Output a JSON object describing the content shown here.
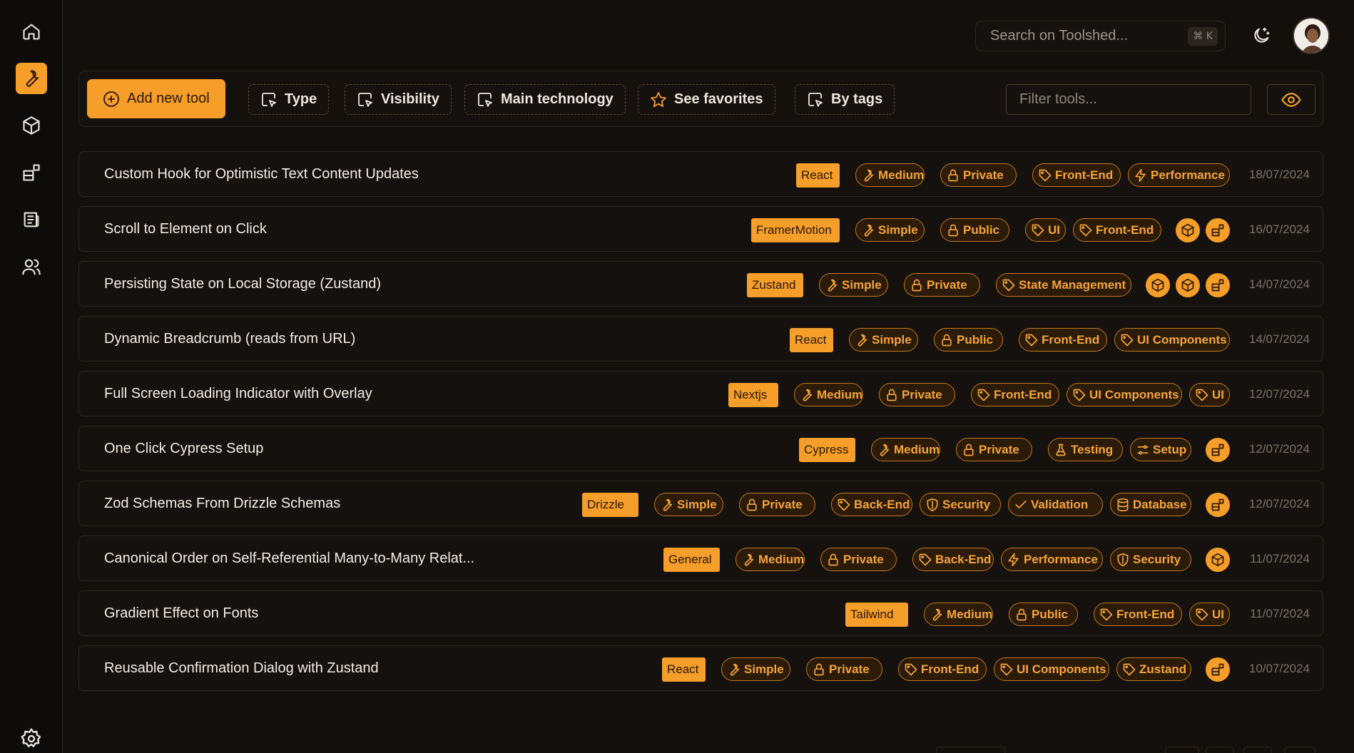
{
  "sidebar": {
    "items": [
      {
        "name": "home",
        "icon": "home-icon",
        "active": false
      },
      {
        "name": "tools",
        "icon": "wrench-icon",
        "active": true
      },
      {
        "name": "packages",
        "icon": "box-icon",
        "active": false
      },
      {
        "name": "components",
        "icon": "blocks-icon",
        "active": false
      },
      {
        "name": "news",
        "icon": "newspaper-icon",
        "active": false
      },
      {
        "name": "users",
        "icon": "users-icon",
        "active": false
      }
    ],
    "settings_icon": "gear-icon"
  },
  "header": {
    "search_placeholder": "Search on Toolshed...",
    "search_shortcut": "⌘ K",
    "theme_icon": "moon-icon"
  },
  "toolbar": {
    "add_label": "Add new tool",
    "type_label": "Type",
    "visibility_label": "Visibility",
    "tech_label": "Main technology",
    "favorites_label": "See favorites",
    "tags_label": "By tags",
    "filter_placeholder": "Filter tools...",
    "view_icon": "eye-icon"
  },
  "colors": {
    "accent": "#f59e2a",
    "background": "#120f0c",
    "chip_bg": "#2c1b08",
    "chip_border": "#c27a1f"
  },
  "tools": [
    {
      "title": "Custom Hook for Optimistic Text Content Updates",
      "tech": "React",
      "level": "Medium",
      "visibility": "Private",
      "tags": [
        {
          "label": "Front-End",
          "icon": "tag"
        },
        {
          "label": "Performance",
          "icon": "bolt"
        }
      ],
      "extras": [],
      "date": "18/07/2024"
    },
    {
      "title": "Scroll to Element on Click",
      "tech": "FramerMotion",
      "level": "Simple",
      "visibility": "Public",
      "tags": [
        {
          "label": "UI",
          "icon": "tag"
        },
        {
          "label": "Front-End",
          "icon": "tag"
        }
      ],
      "extras": [
        "box",
        "blocks"
      ],
      "date": "16/07/2024"
    },
    {
      "title": "Persisting State on Local Storage (Zustand)",
      "tech": "Zustand",
      "level": "Simple",
      "visibility": "Private",
      "tags": [
        {
          "label": "State Management",
          "icon": "tag"
        }
      ],
      "extras": [
        "box",
        "box",
        "blocks"
      ],
      "date": "14/07/2024"
    },
    {
      "title": "Dynamic Breadcrumb (reads from URL)",
      "tech": "React",
      "level": "Simple",
      "visibility": "Public",
      "tags": [
        {
          "label": "Front-End",
          "icon": "tag"
        },
        {
          "label": "UI Components",
          "icon": "tag"
        }
      ],
      "extras": [],
      "date": "14/07/2024"
    },
    {
      "title": "Full Screen Loading Indicator with Overlay",
      "tech": "Nextjs",
      "level": "Medium",
      "visibility": "Private",
      "tags": [
        {
          "label": "Front-End",
          "icon": "tag"
        },
        {
          "label": "UI Components",
          "icon": "tag"
        },
        {
          "label": "UI",
          "icon": "tag"
        }
      ],
      "extras": [],
      "date": "12/07/2024"
    },
    {
      "title": "One Click Cypress Setup",
      "tech": "Cypress",
      "level": "Medium",
      "visibility": "Private",
      "tags": [
        {
          "label": "Testing",
          "icon": "flask"
        },
        {
          "label": "Setup",
          "icon": "sliders"
        }
      ],
      "extras": [
        "blocks"
      ],
      "date": "12/07/2024"
    },
    {
      "title": "Zod Schemas From Drizzle Schemas",
      "tech": "Drizzle",
      "level": "Simple",
      "visibility": "Private",
      "tags": [
        {
          "label": "Back-End",
          "icon": "tag"
        },
        {
          "label": "Security",
          "icon": "shield"
        },
        {
          "label": "Validation",
          "icon": "check"
        },
        {
          "label": "Database",
          "icon": "database"
        }
      ],
      "extras": [
        "blocks"
      ],
      "date": "12/07/2024"
    },
    {
      "title": "Canonical Order on Self-Referential Many-to-Many Relat...",
      "tech": "General",
      "level": "Medium",
      "visibility": "Private",
      "tags": [
        {
          "label": "Back-End",
          "icon": "tag"
        },
        {
          "label": "Performance",
          "icon": "bolt"
        },
        {
          "label": "Security",
          "icon": "shield"
        }
      ],
      "extras": [
        "box"
      ],
      "date": "11/07/2024"
    },
    {
      "title": "Gradient Effect on Fonts",
      "tech": "Tailwind",
      "level": "Medium",
      "visibility": "Public",
      "tags": [
        {
          "label": "Front-End",
          "icon": "tag"
        },
        {
          "label": "UI",
          "icon": "tag"
        }
      ],
      "extras": [],
      "date": "11/07/2024"
    },
    {
      "title": "Reusable Confirmation Dialog with Zustand",
      "tech": "React",
      "level": "Simple",
      "visibility": "Private",
      "tags": [
        {
          "label": "Front-End",
          "icon": "tag"
        },
        {
          "label": "UI Components",
          "icon": "tag"
        },
        {
          "label": "Zustand",
          "icon": "tag"
        }
      ],
      "extras": [
        "blocks"
      ],
      "date": "10/07/2024"
    }
  ]
}
